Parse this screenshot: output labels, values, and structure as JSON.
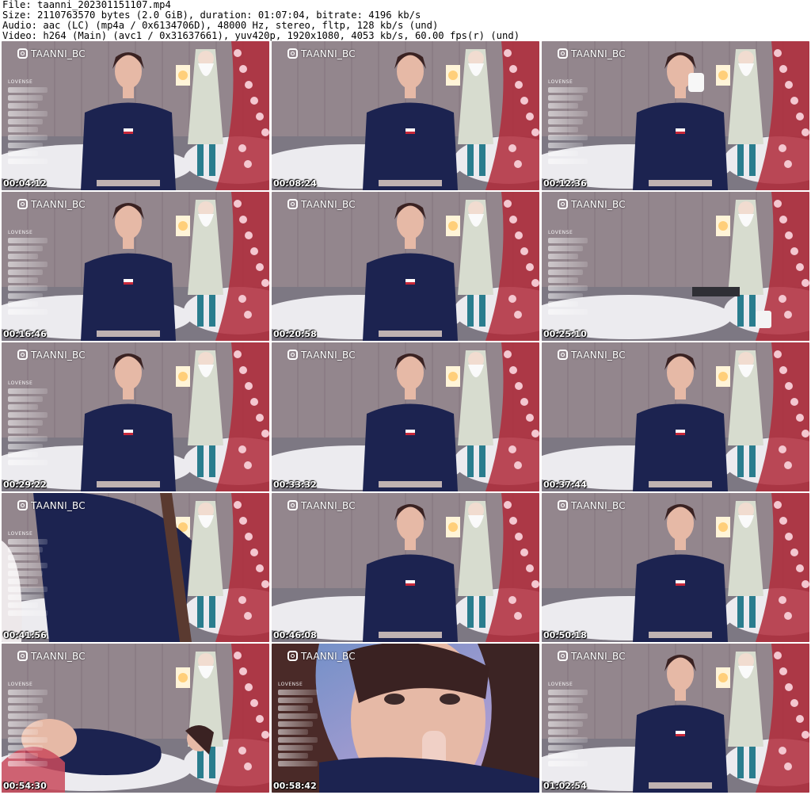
{
  "header": {
    "file_line": "File: taanni_202301151107.mp4",
    "size_line": "Size: 2110763570 bytes (2.0 GiB), duration: 01:07:04, bitrate: 4196 kb/s",
    "audio_line": "Audio: aac (LC) (mp4a / 0x6134706D), 48000 Hz, stereo, fltp, 128 kb/s (und)",
    "video_line": "Video: h264 (Main) (avc1 / 0x31637661), yuv420p, 1920x1080, 4053 kb/s, 60.00 fps(r) (und)"
  },
  "watermark": {
    "handle": "TAANNI_BC",
    "lovense_label": "LOVENSE"
  },
  "colors": {
    "dress": "#1c2350",
    "background_wall": "#8b7d85",
    "fur_rug": "#ecebef",
    "tree": "#b02a3a",
    "timestamp": "#ffffff"
  },
  "thumbnails": [
    {
      "timestamp": "00:04:12"
    },
    {
      "timestamp": "00:08:24"
    },
    {
      "timestamp": "00:12:36"
    },
    {
      "timestamp": "00:16:46"
    },
    {
      "timestamp": "00:20:58"
    },
    {
      "timestamp": "00:25:10"
    },
    {
      "timestamp": "00:29:22"
    },
    {
      "timestamp": "00:33:32"
    },
    {
      "timestamp": "00:37:44"
    },
    {
      "timestamp": "00:41:56"
    },
    {
      "timestamp": "00:46:08"
    },
    {
      "timestamp": "00:50:18"
    },
    {
      "timestamp": "00:54:30"
    },
    {
      "timestamp": "00:58:42"
    },
    {
      "timestamp": "01:02:54"
    }
  ]
}
